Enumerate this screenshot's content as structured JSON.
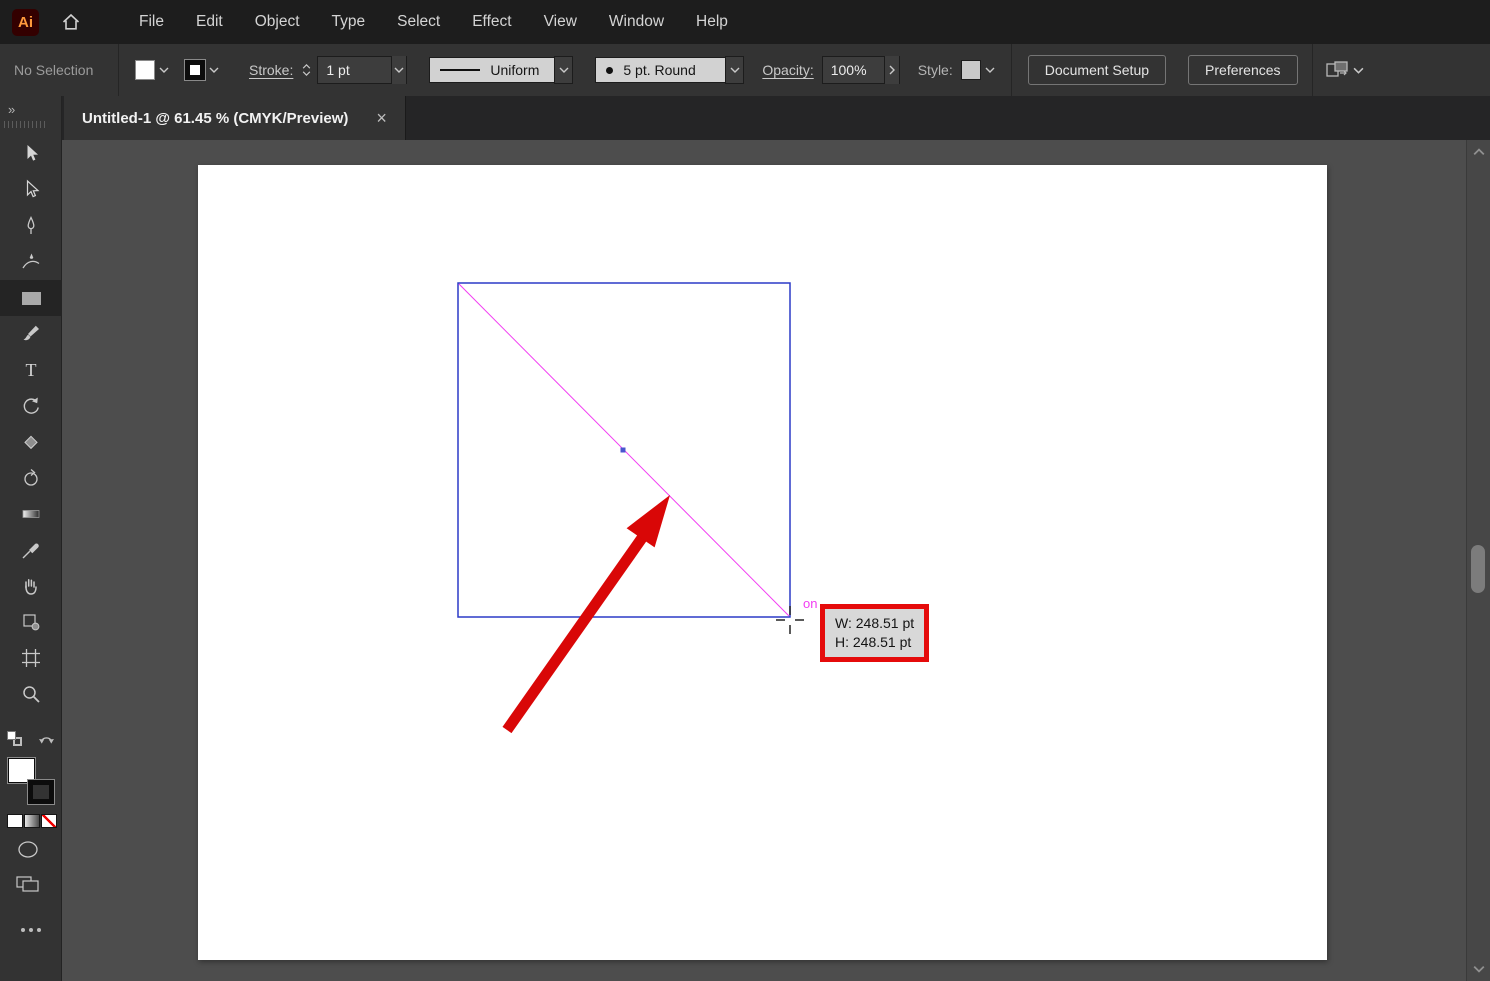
{
  "app": {
    "logo_text": "Ai",
    "menus": [
      "File",
      "Edit",
      "Object",
      "Type",
      "Select",
      "Effect",
      "View",
      "Window",
      "Help"
    ]
  },
  "control_bar": {
    "selection_status": "No Selection",
    "stroke_label": "Stroke:",
    "stroke_weight": "1 pt",
    "profile": "Uniform",
    "brush": "5 pt. Round",
    "opacity_label": "Opacity:",
    "opacity": "100%",
    "style_label": "Style:",
    "document_setup": "Document Setup",
    "preferences": "Preferences"
  },
  "document_tab": {
    "title": "Untitled-1 @ 61.45 % (CMYK/Preview)",
    "close_glyph": "×"
  },
  "tools_panel": {
    "expand_glyph": "»",
    "type_tool_glyph": "T",
    "tools": [
      "selection",
      "direct-selection",
      "pen",
      "curvature",
      "rectangle",
      "paintbrush",
      "type",
      "rotate",
      "eraser",
      "rotate-view",
      "gradient",
      "eyedropper",
      "hand",
      "symbols",
      "artboard",
      "zoom"
    ],
    "active_tool": "rectangle"
  },
  "canvas": {
    "smart_guide_text": "on",
    "tooltip": {
      "width_line": "W: 248.51 pt",
      "height_line": "H: 248.51 pt"
    }
  },
  "colors": {
    "selection_blue": "#2b3ac7",
    "smart_guide_magenta": "#f23df2",
    "annotation_red": "#d90707",
    "logo_orange": "#ff9a3c"
  }
}
